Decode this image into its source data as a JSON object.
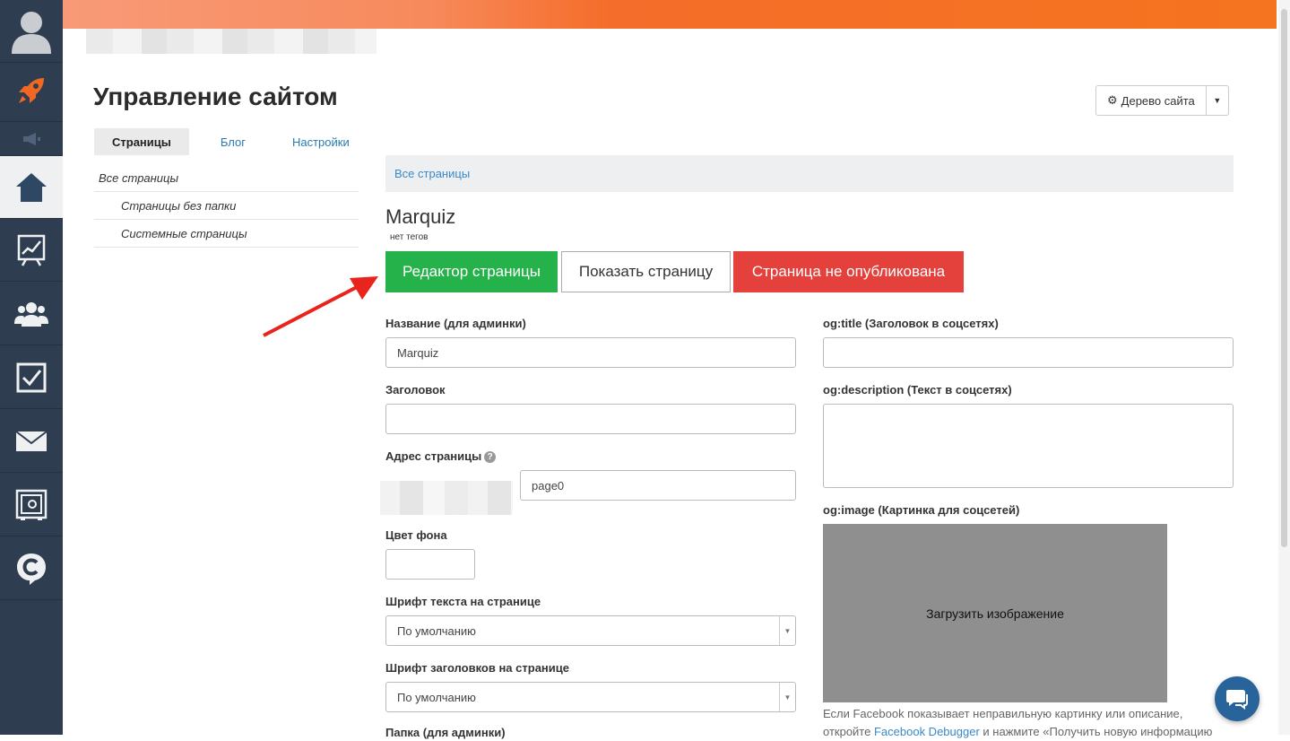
{
  "header": {
    "title": "Управление сайтом",
    "site_tree_button": "Дерево сайта"
  },
  "tabs": [
    {
      "label": "Страницы",
      "active": true
    },
    {
      "label": "Блог",
      "active": false
    },
    {
      "label": "Настройки",
      "active": false
    }
  ],
  "tree": {
    "root": "Все страницы",
    "children": [
      "Страницы без папки",
      "Системные страницы"
    ]
  },
  "breadcrumb": "Все страницы",
  "page": {
    "name": "Marquiz",
    "tags": "нет тегов"
  },
  "actions": {
    "editor": "Редактор страницы",
    "show": "Показать страницу",
    "unpublished": "Страница не опубликована"
  },
  "form": {
    "admin_name_label": "Название (для админки)",
    "admin_name_value": "Marquiz",
    "heading_label": "Заголовок",
    "heading_value": "",
    "address_label": "Адрес страницы",
    "address_value": "page0",
    "bg_color_label": "Цвет фона",
    "text_font_label": "Шрифт текста на странице",
    "text_font_value": "По умолчанию",
    "heading_font_label": "Шрифт заголовков на странице",
    "heading_font_value": "По умолчанию",
    "folder_label": "Папка (для админки)",
    "og_title_label": "og:title (Заголовок в соцсетях)",
    "og_description_label": "og:description (Текст в соцсетях)",
    "og_image_label": "og:image (Картинка для соцсетей)",
    "upload_label": "Загрузить изображение",
    "fb_note_1": "Если Facebook показывает неправильную картинку или описание,",
    "fb_note_2": "откройте",
    "fb_link": "Facebook Debugger",
    "fb_note_3": "и нажмите «Получить новую информацию"
  },
  "colors": {
    "rail": "#2e3d4f",
    "accent_orange": "#f5741f",
    "green": "#26b24a",
    "red": "#e4403c",
    "link": "#3a89c9"
  },
  "icons": [
    "user-avatar-icon",
    "rocket-icon",
    "megaphone-icon",
    "home-icon",
    "chart-icon",
    "users-icon",
    "checkbox-icon",
    "mail-icon",
    "safe-icon",
    "logo-c-icon",
    "gear-icon",
    "chat-icon"
  ]
}
